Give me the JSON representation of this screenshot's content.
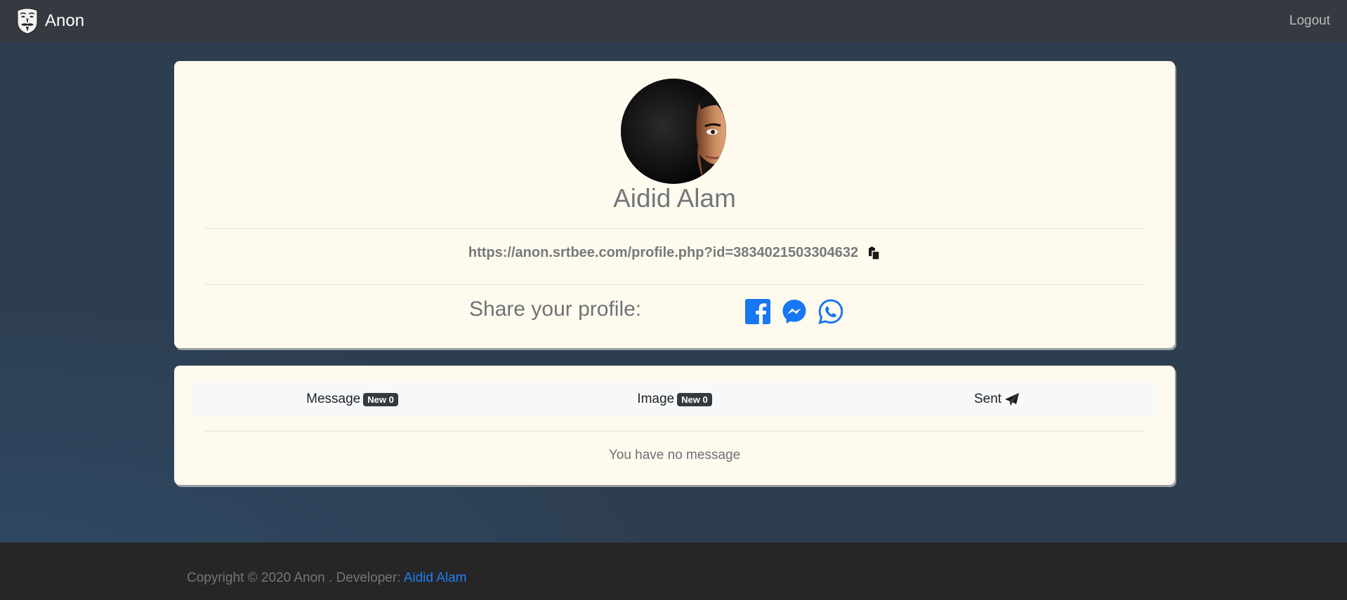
{
  "navbar": {
    "brand": "Anon",
    "logo_icon": "anonymous-mask-icon",
    "logout_label": "Logout"
  },
  "profile": {
    "name": "Aidid Alam",
    "url": "https://anon.srtbee.com/profile.php?id=3834021503304632",
    "copy_icon": "copy-icon",
    "share_label": "Share your profile:",
    "share_icons": [
      "facebook-icon",
      "messenger-icon",
      "whatsapp-icon"
    ]
  },
  "messages": {
    "tabs": [
      {
        "label": "Message",
        "badge": "New 0"
      },
      {
        "label": "Image",
        "badge": "New 0"
      },
      {
        "label": "Sent",
        "icon": "paper-plane-icon"
      }
    ],
    "empty_text": "You have no message"
  },
  "footer": {
    "text": "Copyright © 2020 Anon . Developer: ",
    "developer": "Aidid Alam"
  },
  "colors": {
    "navbar_bg": "#343a40",
    "card_bg": "#fffaee",
    "link_blue": "#1f7ef2",
    "social_blue": "#1877f2",
    "footer_bg": "#262626"
  }
}
